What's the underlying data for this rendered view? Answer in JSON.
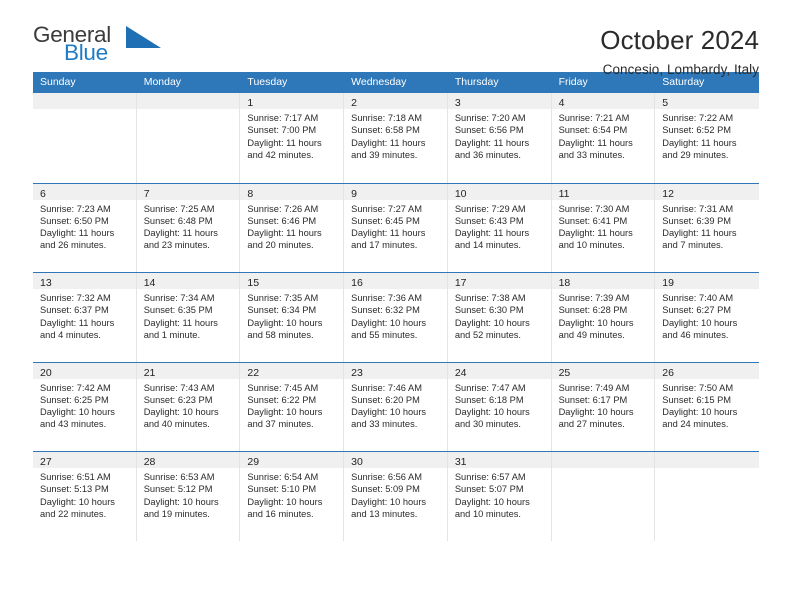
{
  "brand": {
    "name_part1": "General",
    "name_part2": "Blue",
    "logo_icon": "triangle-logo-icon",
    "color_dark": "#3b3b3b",
    "color_blue": "#1f7cc4"
  },
  "header": {
    "title": "October 2024",
    "subtitle": "Concesio, Lombardy, Italy"
  },
  "theme": {
    "header_blue": "#2e77b8",
    "day_band_gray": "#f0f0f0",
    "text": "#231f20"
  },
  "weekdays": [
    {
      "label": "Sunday"
    },
    {
      "label": "Monday"
    },
    {
      "label": "Tuesday"
    },
    {
      "label": "Wednesday"
    },
    {
      "label": "Thursday"
    },
    {
      "label": "Friday"
    },
    {
      "label": "Saturday"
    }
  ],
  "weeks": [
    [
      {
        "day": "",
        "sunrise": "",
        "sunset": "",
        "daylight_line1": "",
        "daylight_line2": ""
      },
      {
        "day": "",
        "sunrise": "",
        "sunset": "",
        "daylight_line1": "",
        "daylight_line2": ""
      },
      {
        "day": "1",
        "sunrise": "Sunrise: 7:17 AM",
        "sunset": "Sunset: 7:00 PM",
        "daylight_line1": "Daylight: 11 hours",
        "daylight_line2": "and 42 minutes."
      },
      {
        "day": "2",
        "sunrise": "Sunrise: 7:18 AM",
        "sunset": "Sunset: 6:58 PM",
        "daylight_line1": "Daylight: 11 hours",
        "daylight_line2": "and 39 minutes."
      },
      {
        "day": "3",
        "sunrise": "Sunrise: 7:20 AM",
        "sunset": "Sunset: 6:56 PM",
        "daylight_line1": "Daylight: 11 hours",
        "daylight_line2": "and 36 minutes."
      },
      {
        "day": "4",
        "sunrise": "Sunrise: 7:21 AM",
        "sunset": "Sunset: 6:54 PM",
        "daylight_line1": "Daylight: 11 hours",
        "daylight_line2": "and 33 minutes."
      },
      {
        "day": "5",
        "sunrise": "Sunrise: 7:22 AM",
        "sunset": "Sunset: 6:52 PM",
        "daylight_line1": "Daylight: 11 hours",
        "daylight_line2": "and 29 minutes."
      }
    ],
    [
      {
        "day": "6",
        "sunrise": "Sunrise: 7:23 AM",
        "sunset": "Sunset: 6:50 PM",
        "daylight_line1": "Daylight: 11 hours",
        "daylight_line2": "and 26 minutes."
      },
      {
        "day": "7",
        "sunrise": "Sunrise: 7:25 AM",
        "sunset": "Sunset: 6:48 PM",
        "daylight_line1": "Daylight: 11 hours",
        "daylight_line2": "and 23 minutes."
      },
      {
        "day": "8",
        "sunrise": "Sunrise: 7:26 AM",
        "sunset": "Sunset: 6:46 PM",
        "daylight_line1": "Daylight: 11 hours",
        "daylight_line2": "and 20 minutes."
      },
      {
        "day": "9",
        "sunrise": "Sunrise: 7:27 AM",
        "sunset": "Sunset: 6:45 PM",
        "daylight_line1": "Daylight: 11 hours",
        "daylight_line2": "and 17 minutes."
      },
      {
        "day": "10",
        "sunrise": "Sunrise: 7:29 AM",
        "sunset": "Sunset: 6:43 PM",
        "daylight_line1": "Daylight: 11 hours",
        "daylight_line2": "and 14 minutes."
      },
      {
        "day": "11",
        "sunrise": "Sunrise: 7:30 AM",
        "sunset": "Sunset: 6:41 PM",
        "daylight_line1": "Daylight: 11 hours",
        "daylight_line2": "and 10 minutes."
      },
      {
        "day": "12",
        "sunrise": "Sunrise: 7:31 AM",
        "sunset": "Sunset: 6:39 PM",
        "daylight_line1": "Daylight: 11 hours",
        "daylight_line2": "and 7 minutes."
      }
    ],
    [
      {
        "day": "13",
        "sunrise": "Sunrise: 7:32 AM",
        "sunset": "Sunset: 6:37 PM",
        "daylight_line1": "Daylight: 11 hours",
        "daylight_line2": "and 4 minutes."
      },
      {
        "day": "14",
        "sunrise": "Sunrise: 7:34 AM",
        "sunset": "Sunset: 6:35 PM",
        "daylight_line1": "Daylight: 11 hours",
        "daylight_line2": "and 1 minute."
      },
      {
        "day": "15",
        "sunrise": "Sunrise: 7:35 AM",
        "sunset": "Sunset: 6:34 PM",
        "daylight_line1": "Daylight: 10 hours",
        "daylight_line2": "and 58 minutes."
      },
      {
        "day": "16",
        "sunrise": "Sunrise: 7:36 AM",
        "sunset": "Sunset: 6:32 PM",
        "daylight_line1": "Daylight: 10 hours",
        "daylight_line2": "and 55 minutes."
      },
      {
        "day": "17",
        "sunrise": "Sunrise: 7:38 AM",
        "sunset": "Sunset: 6:30 PM",
        "daylight_line1": "Daylight: 10 hours",
        "daylight_line2": "and 52 minutes."
      },
      {
        "day": "18",
        "sunrise": "Sunrise: 7:39 AM",
        "sunset": "Sunset: 6:28 PM",
        "daylight_line1": "Daylight: 10 hours",
        "daylight_line2": "and 49 minutes."
      },
      {
        "day": "19",
        "sunrise": "Sunrise: 7:40 AM",
        "sunset": "Sunset: 6:27 PM",
        "daylight_line1": "Daylight: 10 hours",
        "daylight_line2": "and 46 minutes."
      }
    ],
    [
      {
        "day": "20",
        "sunrise": "Sunrise: 7:42 AM",
        "sunset": "Sunset: 6:25 PM",
        "daylight_line1": "Daylight: 10 hours",
        "daylight_line2": "and 43 minutes."
      },
      {
        "day": "21",
        "sunrise": "Sunrise: 7:43 AM",
        "sunset": "Sunset: 6:23 PM",
        "daylight_line1": "Daylight: 10 hours",
        "daylight_line2": "and 40 minutes."
      },
      {
        "day": "22",
        "sunrise": "Sunrise: 7:45 AM",
        "sunset": "Sunset: 6:22 PM",
        "daylight_line1": "Daylight: 10 hours",
        "daylight_line2": "and 37 minutes."
      },
      {
        "day": "23",
        "sunrise": "Sunrise: 7:46 AM",
        "sunset": "Sunset: 6:20 PM",
        "daylight_line1": "Daylight: 10 hours",
        "daylight_line2": "and 33 minutes."
      },
      {
        "day": "24",
        "sunrise": "Sunrise: 7:47 AM",
        "sunset": "Sunset: 6:18 PM",
        "daylight_line1": "Daylight: 10 hours",
        "daylight_line2": "and 30 minutes."
      },
      {
        "day": "25",
        "sunrise": "Sunrise: 7:49 AM",
        "sunset": "Sunset: 6:17 PM",
        "daylight_line1": "Daylight: 10 hours",
        "daylight_line2": "and 27 minutes."
      },
      {
        "day": "26",
        "sunrise": "Sunrise: 7:50 AM",
        "sunset": "Sunset: 6:15 PM",
        "daylight_line1": "Daylight: 10 hours",
        "daylight_line2": "and 24 minutes."
      }
    ],
    [
      {
        "day": "27",
        "sunrise": "Sunrise: 6:51 AM",
        "sunset": "Sunset: 5:13 PM",
        "daylight_line1": "Daylight: 10 hours",
        "daylight_line2": "and 22 minutes."
      },
      {
        "day": "28",
        "sunrise": "Sunrise: 6:53 AM",
        "sunset": "Sunset: 5:12 PM",
        "daylight_line1": "Daylight: 10 hours",
        "daylight_line2": "and 19 minutes."
      },
      {
        "day": "29",
        "sunrise": "Sunrise: 6:54 AM",
        "sunset": "Sunset: 5:10 PM",
        "daylight_line1": "Daylight: 10 hours",
        "daylight_line2": "and 16 minutes."
      },
      {
        "day": "30",
        "sunrise": "Sunrise: 6:56 AM",
        "sunset": "Sunset: 5:09 PM",
        "daylight_line1": "Daylight: 10 hours",
        "daylight_line2": "and 13 minutes."
      },
      {
        "day": "31",
        "sunrise": "Sunrise: 6:57 AM",
        "sunset": "Sunset: 5:07 PM",
        "daylight_line1": "Daylight: 10 hours",
        "daylight_line2": "and 10 minutes."
      },
      {
        "day": "",
        "sunrise": "",
        "sunset": "",
        "daylight_line1": "",
        "daylight_line2": ""
      },
      {
        "day": "",
        "sunrise": "",
        "sunset": "",
        "daylight_line1": "",
        "daylight_line2": ""
      }
    ]
  ]
}
